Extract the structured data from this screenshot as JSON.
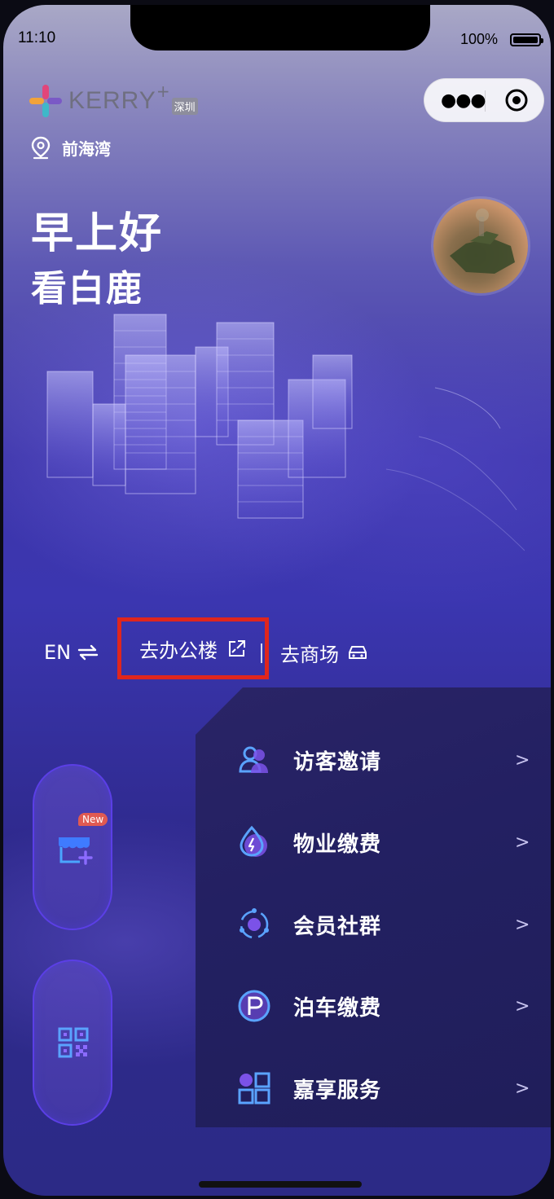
{
  "status_bar": {
    "time": "11:10",
    "battery": "100%"
  },
  "brand": {
    "name": "KERRY",
    "plus": "+",
    "city": "深圳"
  },
  "capsule": {
    "menu_icon": "more-dots-icon",
    "close_icon": "target-circle-icon"
  },
  "location": {
    "name": "前海湾",
    "icon": "location-pin-icon"
  },
  "greeting": {
    "title": "早上好",
    "name": "看白鹿"
  },
  "nav": {
    "language_label": "EN",
    "language_icon": "swap-arrows-icon",
    "office_label": "去办公楼",
    "office_icon": "open-external-icon",
    "mall_label": "去商场",
    "mall_icon": "car-icon"
  },
  "side_buttons": [
    {
      "name": "store-add",
      "badge": "New",
      "icon": "store-add-icon"
    },
    {
      "name": "qr-code",
      "icon": "qr-code-icon"
    }
  ],
  "menu": {
    "items": [
      {
        "label": "访客邀请",
        "icon": "visitor-icon"
      },
      {
        "label": "物业缴费",
        "icon": "water-drop-icon"
      },
      {
        "label": "会员社群",
        "icon": "community-orbit-icon"
      },
      {
        "label": "泊车缴费",
        "icon": "parking-icon"
      },
      {
        "label": "嘉享服务",
        "icon": "grid-service-icon"
      }
    ],
    "chevron": ">"
  },
  "colors": {
    "background_top": "#a9a8c6",
    "background_main": "#3d35a9",
    "panel": "#232062",
    "highlight_border": "#e0261d",
    "accent_purple": "#5b3fe6",
    "badge": "#e05a52"
  }
}
